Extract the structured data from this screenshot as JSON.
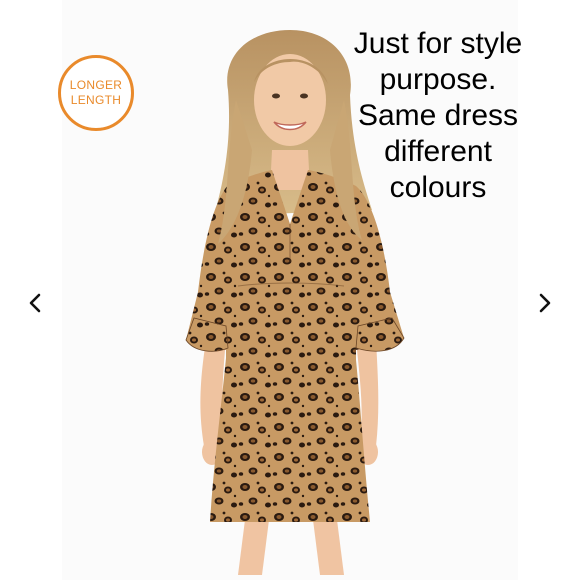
{
  "badge": {
    "line1": "LONGER",
    "line2": "LENGTH",
    "color": "#e98a2b"
  },
  "overlay": {
    "lines": [
      "Just for style",
      "purpose.",
      "Same dress",
      "different",
      "colours"
    ]
  },
  "carousel": {
    "prev_icon": "chevron-left-icon",
    "next_icon": "chevron-right-icon"
  }
}
